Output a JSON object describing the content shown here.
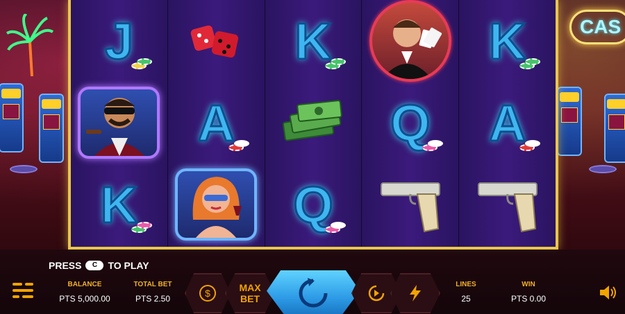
{
  "game": {
    "background_sign": "CAS"
  },
  "reels": [
    [
      {
        "type": "letter",
        "symbol": "J"
      },
      {
        "type": "portrait",
        "symbol": "mobster-with-cigar"
      },
      {
        "type": "letter",
        "symbol": "K"
      }
    ],
    [
      {
        "type": "dice",
        "symbol": "red-dice"
      },
      {
        "type": "letter",
        "symbol": "A"
      },
      {
        "type": "portrait",
        "symbol": "blonde-lady-with-wine"
      }
    ],
    [
      {
        "type": "letter",
        "symbol": "K"
      },
      {
        "type": "money",
        "symbol": "cash-stack"
      },
      {
        "type": "letter",
        "symbol": "Q"
      }
    ],
    [
      {
        "type": "portrait-round",
        "symbol": "card-dealer"
      },
      {
        "type": "letter",
        "symbol": "Q"
      },
      {
        "type": "gun",
        "symbol": "silver-pistol"
      }
    ],
    [
      {
        "type": "letter",
        "symbol": "K"
      },
      {
        "type": "letter",
        "symbol": "A"
      },
      {
        "type": "gun",
        "symbol": "silver-pistol"
      }
    ]
  ],
  "controls": {
    "press_text": "PRESS",
    "press_key": "C",
    "press_suffix": "TO PLAY",
    "balance_label": "BALANCE",
    "balance_value": "PTS 5,000.00",
    "total_bet_label": "TOTAL BET",
    "total_bet_value": "PTS 2.50",
    "max_bet_line1": "MAX",
    "max_bet_line2": "BET",
    "lines_label": "LINES",
    "lines_value": "25",
    "win_label": "WIN",
    "win_value": "PTS 0.00"
  },
  "colors": {
    "frame_gold": "#e9c64b",
    "accent_orange": "#f2a300",
    "spin_blue": "#2d9be6",
    "letter_cyan": "#3fb6f0"
  }
}
